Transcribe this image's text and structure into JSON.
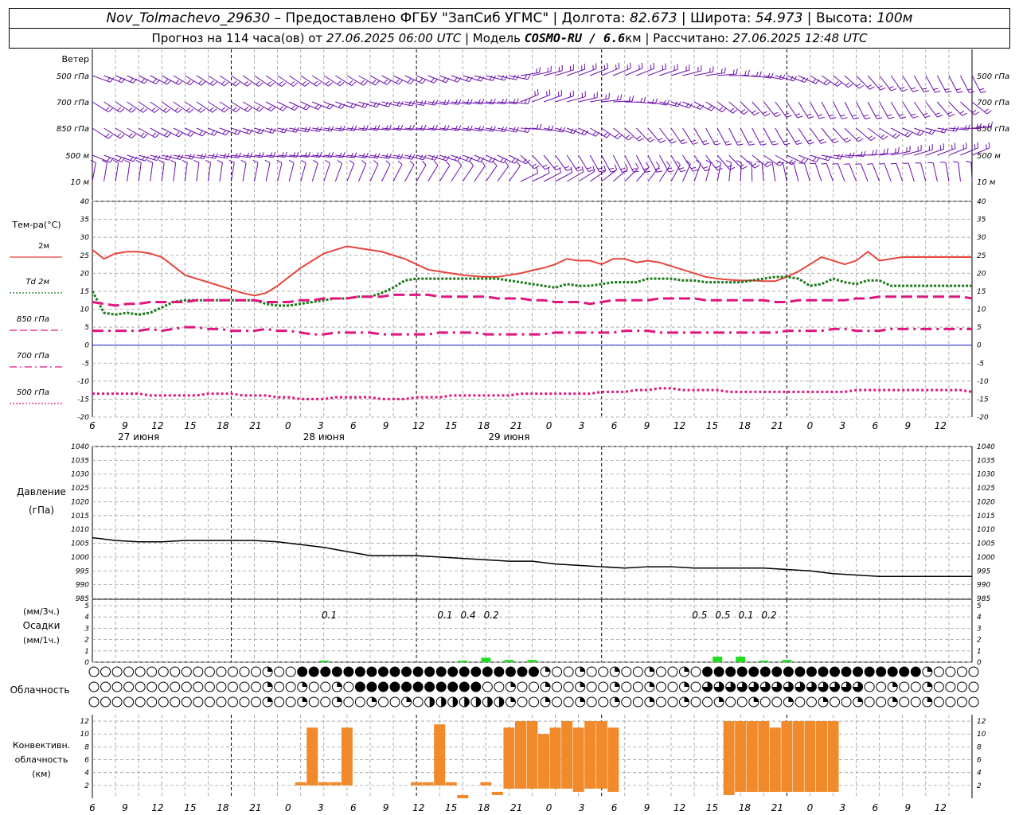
{
  "header": {
    "station": "Nov_Tolmachevo_29630",
    "provider": " – Предоставлено ФГБУ \"ЗапСиб УГМС\" | Долгота: ",
    "lon": "82.673",
    "lat_label": " | Широта: ",
    "lat": "54.973",
    "alt_label": " | Высота: ",
    "alt": "100м",
    "forecast_label": "Прогноз на 114 часа(ов) от ",
    "forecast_time": "27.06.2025 06:00 UTC",
    "model_label": " | Модель ",
    "model": "COSMO-RU / 6.6",
    "model_unit": "км",
    "calc_label": " | Рассчитано: ",
    "calc_time": "27.06.2025 12:48 UTC"
  },
  "time_axis": {
    "hours": [
      "6",
      "9",
      "12",
      "15",
      "18",
      "21",
      "0",
      "3",
      "6",
      "9",
      "12",
      "15",
      "18",
      "21",
      "0",
      "3",
      "6",
      "9",
      "12",
      "15",
      "18",
      "21",
      "0",
      "3",
      "6",
      "9",
      "12"
    ],
    "day_labels": [
      "27 июня",
      "28 июня",
      "29 июня"
    ]
  },
  "wind_panel": {
    "title": "Ветер",
    "levels": [
      "500 гПа",
      "700 гПа",
      "850 гПа",
      "500 м",
      "10 м"
    ],
    "right_levels": [
      "500 гПа",
      "700 гПа",
      "850 гПа",
      "500 м",
      "10 м"
    ],
    "color": "#6a0dad"
  },
  "temp_panel": {
    "title": "Тем-ра(°С)",
    "legend": [
      {
        "label": "2м",
        "color": "#e8453c",
        "style": "solid"
      },
      {
        "label": "Td  2м",
        "color": "#1a7a1a",
        "style": "dotted"
      },
      {
        "label": "850 гПа",
        "color": "#e0157d",
        "style": "dashed"
      },
      {
        "label": "700 гПа",
        "color": "#e0157d",
        "style": "dashdot"
      },
      {
        "label": "500 гПа",
        "color": "#e0157d",
        "style": "dot"
      }
    ],
    "yticks": [
      "40",
      "35",
      "30",
      "25",
      "20",
      "15",
      "10",
      "5",
      "0",
      "-5",
      "-10",
      "-15",
      "-20"
    ]
  },
  "pressure_panel": {
    "title": "Давление",
    "unit": "(гПа)",
    "yticks": [
      "1040",
      "1035",
      "1030",
      "1025",
      "1020",
      "1015",
      "1010",
      "1005",
      "1000",
      "995",
      "990",
      "985"
    ]
  },
  "precip_panel": {
    "label_3h": "(мм/3ч.)",
    "title": "Осадки",
    "label_1h": "(мм/1ч.)",
    "yticks": [
      "5",
      "4",
      "3",
      "2",
      "1",
      "0"
    ],
    "annotations": [
      "0.1",
      "0.1",
      "0.4",
      "0.2",
      "0.5",
      "0.5",
      "0.1",
      "0.2"
    ]
  },
  "cloud_panel": {
    "title": "Облачность"
  },
  "conv_panel": {
    "title_1": "Конвективн.",
    "title_2": "облачность",
    "unit": "(км)",
    "yticks": [
      "12",
      "10",
      "8",
      "6",
      "4",
      "2"
    ]
  },
  "chart_data": [
    {
      "type": "line",
      "title": "Тем-ра(°С)",
      "x_hours_from_start": [
        0,
        1.5,
        3,
        4.5,
        6,
        7.5,
        9,
        10.5,
        12,
        13.5,
        15,
        16.5,
        18,
        19.5,
        21,
        22.5,
        24,
        25.5,
        27,
        28.5,
        30,
        31.5,
        33,
        34.5,
        36,
        37.5,
        39,
        40.5,
        42,
        43.5,
        45,
        46.5,
        48,
        49.5,
        51,
        52.5,
        54,
        55.5,
        57,
        58.5,
        60,
        61.5,
        63,
        64.5,
        66,
        67.5,
        69,
        70.5,
        72,
        73.5,
        75,
        76.5,
        78,
        79.5,
        81,
        82.5,
        84,
        85.5,
        87,
        88.5,
        90,
        91.5,
        93,
        94.5,
        96,
        97.5,
        99,
        100.5,
        102,
        103.5,
        105,
        106.5,
        108,
        109.5,
        111,
        112.5,
        114
      ],
      "series": [
        {
          "name": "2м",
          "values": [
            26.5,
            24,
            25.5,
            26,
            26,
            25.5,
            24.5,
            22,
            19.5,
            18.5,
            17.5,
            16.5,
            15.5,
            14.5,
            13.8,
            14.5,
            16.5,
            19,
            21.5,
            23.5,
            25.5,
            26.5,
            27.5,
            27,
            26.5,
            26,
            25,
            24,
            22.5,
            21,
            20.5,
            20,
            19.5,
            19.2,
            19,
            19,
            19.5,
            20,
            20.8,
            21.5,
            22.5,
            24,
            23.5,
            23.5,
            22.5,
            24,
            24,
            23,
            23.5,
            23,
            22,
            21,
            20,
            19,
            18.5,
            18.2,
            18,
            18,
            17.8,
            17.8,
            19,
            20.5,
            22.5,
            24.5,
            23.5,
            22.5,
            23.5,
            26,
            23.5,
            24,
            24.5,
            24.5,
            24.5,
            24.5,
            24.5,
            24.5,
            24.5
          ]
        },
        {
          "name": "Td  2м",
          "values": [
            15,
            9,
            8.5,
            9,
            8.5,
            9,
            10.5,
            12,
            12.5,
            12.5,
            12.5,
            12.5,
            12.5,
            12.5,
            12.5,
            11.5,
            11,
            11,
            11.5,
            12,
            12.5,
            13,
            13,
            13.5,
            13.5,
            14.5,
            16,
            18,
            18.5,
            18.5,
            18.5,
            18.5,
            18.5,
            18.5,
            18.5,
            18.5,
            18,
            17.5,
            17,
            16.5,
            16,
            17,
            16.5,
            16.5,
            17,
            17.5,
            17.5,
            17.5,
            18.5,
            18.5,
            18.5,
            18,
            18,
            17.5,
            17.5,
            17.5,
            17.5,
            18,
            18.5,
            19,
            19,
            18.5,
            16.5,
            17,
            18.5,
            17.5,
            17,
            18,
            18,
            16.5,
            16.5,
            16.5,
            16.5,
            16.5,
            16.5,
            16.5,
            16.5
          ]
        },
        {
          "name": "850 гПа",
          "values": [
            12,
            11.5,
            11,
            11.5,
            11.5,
            12,
            12,
            12,
            12,
            12.5,
            12.5,
            12.5,
            12.5,
            12.5,
            12.5,
            12,
            12,
            12,
            12.5,
            12.5,
            13,
            13,
            13,
            13.5,
            13.5,
            13.5,
            14,
            14,
            14,
            14,
            13.5,
            13.5,
            13.5,
            13.5,
            13.5,
            13,
            13,
            13,
            12.5,
            12.5,
            12,
            12,
            12,
            11.5,
            12,
            12.5,
            12.5,
            12.5,
            12.5,
            13,
            13,
            13,
            13,
            12.5,
            12.5,
            12.5,
            12.5,
            12.5,
            12.5,
            12,
            12,
            12.5,
            12.5,
            12.5,
            12.5,
            12.5,
            13,
            13,
            13.5,
            13.5,
            13.5,
            13.5,
            13.5,
            13.5,
            13.5,
            13.5,
            13
          ]
        },
        {
          "name": "700 гПа",
          "values": [
            4,
            4,
            4,
            4,
            4,
            4.5,
            4,
            4.5,
            5,
            5,
            4.5,
            4.5,
            4,
            4,
            4,
            4.5,
            4,
            4,
            3.5,
            3,
            3,
            3.5,
            3.5,
            3.5,
            3.5,
            3,
            3,
            3,
            3,
            3,
            3.5,
            3.5,
            3.5,
            3.5,
            3,
            3,
            3,
            3,
            3,
            3,
            3.5,
            3.5,
            3.5,
            3.5,
            3.5,
            3.5,
            4,
            4,
            4,
            3.5,
            3.5,
            3.5,
            3.5,
            3.5,
            3.5,
            3.5,
            3.5,
            3.5,
            3.5,
            3.5,
            4,
            4,
            4,
            4,
            4.5,
            4.5,
            4,
            4,
            4,
            4.5,
            4.5,
            4.5,
            4.5,
            4.5,
            4.5,
            4.5,
            4.5
          ]
        },
        {
          "name": "500 гПа",
          "values": [
            -13.5,
            -13.5,
            -13.5,
            -13.5,
            -13.5,
            -14,
            -14,
            -14,
            -14,
            -14,
            -13.5,
            -13.5,
            -13.5,
            -14,
            -14,
            -14,
            -14.5,
            -14.5,
            -15,
            -15,
            -15,
            -14.5,
            -14.5,
            -14.5,
            -14.5,
            -15,
            -15,
            -15,
            -14.5,
            -14.5,
            -14.5,
            -14,
            -14,
            -14,
            -14,
            -14,
            -14,
            -13.5,
            -13.5,
            -13.5,
            -13.5,
            -13.5,
            -13.5,
            -13.5,
            -13,
            -13,
            -13,
            -12.5,
            -12.5,
            -12,
            -12,
            -12.5,
            -12.5,
            -12.5,
            -12.5,
            -13,
            -13,
            -13,
            -13,
            -13,
            -13,
            -13,
            -13,
            -13,
            -13,
            -13,
            -12.5,
            -12.5,
            -12.5,
            -12.5,
            -12.5,
            -12.5,
            -12.5,
            -12.5,
            -12.5,
            -12.5,
            -13
          ]
        }
      ],
      "ylim": [
        -20,
        40
      ]
    },
    {
      "type": "line",
      "title": "Давление",
      "x_hours_from_start": [
        0,
        3,
        6,
        9,
        12,
        15,
        18,
        21,
        24,
        27,
        30,
        33,
        36,
        39,
        42,
        45,
        48,
        51,
        54,
        57,
        60,
        63,
        66,
        69,
        72,
        75,
        78,
        81,
        84,
        87,
        90,
        93,
        96,
        99,
        102,
        105,
        108,
        111,
        114
      ],
      "series": [
        {
          "name": "Давление",
          "values": [
            1007,
            1006,
            1005.5,
            1005.5,
            1006,
            1006,
            1006,
            1006,
            1005.5,
            1004.5,
            1003.5,
            1002,
            1000.5,
            1000.5,
            1000.5,
            1000,
            999.5,
            999,
            998.5,
            998.5,
            997.5,
            997,
            996.5,
            996,
            996.5,
            996.5,
            996,
            996,
            996,
            996,
            995.5,
            995,
            994,
            993.5,
            993,
            993,
            993,
            993,
            993
          ]
        }
      ],
      "ylim": [
        985,
        1040
      ]
    },
    {
      "type": "bar",
      "title": "Осадки",
      "x_hours_from_start": [
        30,
        48,
        51,
        54,
        57,
        81,
        84,
        87,
        90
      ],
      "series": [
        {
          "name": "мм/3ч",
          "values": [
            0.1,
            0.1,
            0.4,
            0.2,
            0.2,
            0.5,
            0.5,
            0.1,
            0.2
          ]
        }
      ],
      "ylim": [
        0,
        5
      ]
    },
    {
      "type": "bar",
      "title": "Конвективн. облачность",
      "x_hours_from_start": [
        27,
        28.5,
        30,
        31.5,
        33,
        42,
        43.5,
        45,
        46.5,
        48,
        49.5,
        51,
        52.5,
        54,
        55.5,
        57,
        58.5,
        60,
        61.5,
        63,
        64.5,
        66,
        67.5,
        69,
        82.5,
        84,
        85.5,
        87,
        88.5,
        90,
        91.5,
        93,
        94.5,
        96
      ],
      "series": [
        {
          "name": "top",
          "values": [
            2.5,
            11,
            2.5,
            2.5,
            11,
            2.5,
            2.5,
            11.5,
            2.5,
            0.5,
            0,
            2.5,
            1,
            11,
            12,
            12,
            10,
            11,
            12,
            11,
            12,
            12,
            11,
            0,
            12,
            12,
            12,
            12,
            11,
            12,
            12,
            12,
            12,
            12
          ]
        },
        {
          "name": "base",
          "values": [
            2,
            2,
            2,
            2,
            2,
            2,
            2,
            2,
            2,
            0,
            0,
            2,
            0.5,
            1.5,
            1.5,
            1.5,
            1.5,
            1.5,
            1.5,
            1,
            1.5,
            1.5,
            1,
            0,
            0.5,
            1,
            1,
            1,
            1,
            1,
            1,
            1,
            1,
            1
          ]
        }
      ],
      "ylim": [
        0,
        13
      ]
    }
  ]
}
